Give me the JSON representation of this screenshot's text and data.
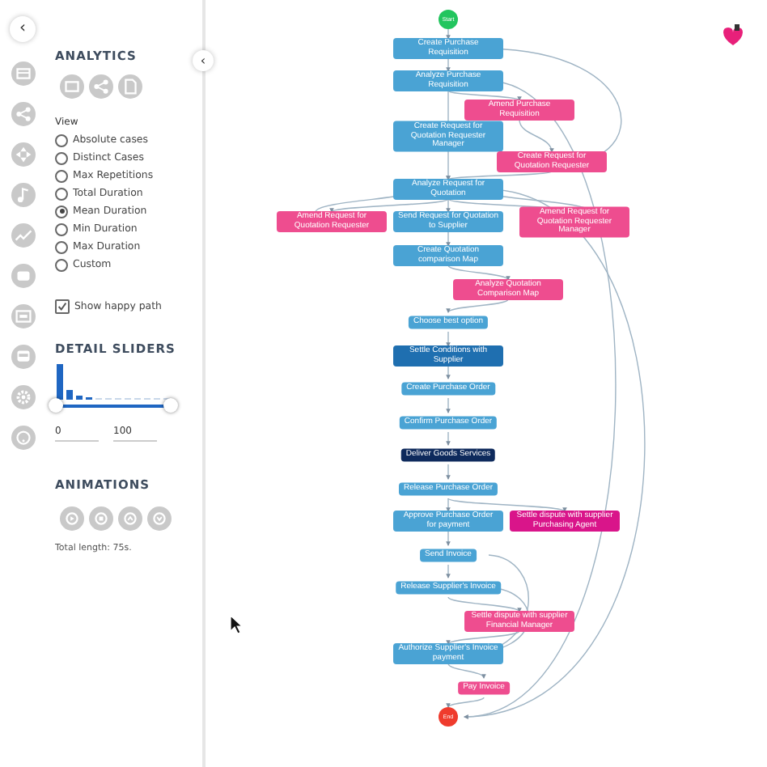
{
  "sidebar": {
    "back_label": "‹"
  },
  "panel": {
    "collapse_label": "‹",
    "analytics_title": "ANALYTICS",
    "view_label": "View",
    "view_options": [
      {
        "label": "Absolute cases",
        "selected": false
      },
      {
        "label": "Distinct Cases",
        "selected": false
      },
      {
        "label": "Max Repetitions",
        "selected": false
      },
      {
        "label": "Total Duration",
        "selected": false
      },
      {
        "label": "Mean Duration",
        "selected": true
      },
      {
        "label": "Min Duration",
        "selected": false
      },
      {
        "label": "Max Duration",
        "selected": false
      },
      {
        "label": "Custom",
        "selected": false
      }
    ],
    "happy_path": {
      "label": "Show happy path",
      "checked": true
    },
    "detail_title": "DETAIL SLIDERS",
    "slider": {
      "level": 1
    },
    "range_min": "0",
    "range_max": "100",
    "animations_title": "ANIMATIONS",
    "total_length": "Total length: 75s."
  },
  "process_map": {
    "nodes": [
      {
        "kind": "start",
        "label": "Start",
        "color": "#22c55e"
      },
      {
        "kind": "activity",
        "label": "Create Purchase Requisition",
        "color": "#4aa3d4"
      },
      {
        "kind": "activity",
        "label": "Analyze Purchase Requisition",
        "color": "#4aa3d4"
      },
      {
        "kind": "activity",
        "label": "Amend Purchase Requisition",
        "color": "#ee4d8f"
      },
      {
        "kind": "activity",
        "label": "Create Request for Quotation Requester Manager",
        "color": "#4aa3d4"
      },
      {
        "kind": "activity",
        "label": "Create Request for Quotation Requester",
        "color": "#ee4d8f"
      },
      {
        "kind": "activity",
        "label": "Analyze Request for Quotation",
        "color": "#4aa3d4"
      },
      {
        "kind": "activity",
        "label": "Amend Request for Quotation Requester",
        "color": "#ee4d8f"
      },
      {
        "kind": "activity",
        "label": "Send Request for Quotation to Supplier",
        "color": "#4aa3d4"
      },
      {
        "kind": "activity",
        "label": "Amend Request for Quotation Requester Manager",
        "color": "#ee4d8f"
      },
      {
        "kind": "activity",
        "label": "Create Quotation comparison Map",
        "color": "#4aa3d4"
      },
      {
        "kind": "activity",
        "label": "Analyze Quotation Comparison Map",
        "color": "#ee4d8f"
      },
      {
        "kind": "activity",
        "label": "Choose best option",
        "color": "#4aa3d4"
      },
      {
        "kind": "activity",
        "label": "Settle Conditions with Supplier",
        "color": "#1f6fb0"
      },
      {
        "kind": "activity",
        "label": "Create Purchase Order",
        "color": "#4aa3d4"
      },
      {
        "kind": "activity",
        "label": "Confirm Purchase Order",
        "color": "#4aa3d4"
      },
      {
        "kind": "activity",
        "label": "Deliver Goods Services",
        "color": "#0e2a5c"
      },
      {
        "kind": "activity",
        "label": "Release Purchase Order",
        "color": "#4aa3d4"
      },
      {
        "kind": "activity",
        "label": "Approve Purchase Order for payment",
        "color": "#4aa3d4"
      },
      {
        "kind": "activity",
        "label": "Settle dispute with supplier Purchasing Agent",
        "color": "#d9158a"
      },
      {
        "kind": "activity",
        "label": "Send Invoice",
        "color": "#4aa3d4"
      },
      {
        "kind": "activity",
        "label": "Release Supplier's Invoice",
        "color": "#4aa3d4"
      },
      {
        "kind": "activity",
        "label": "Settle dispute with supplier Financial Manager",
        "color": "#ee4d8f"
      },
      {
        "kind": "activity",
        "label": "Authorize Supplier's Invoice payment",
        "color": "#4aa3d4"
      },
      {
        "kind": "activity",
        "label": "Pay Invoice",
        "color": "#ee4d8f"
      },
      {
        "kind": "end",
        "label": "End",
        "color": "#ef3b2d"
      }
    ]
  }
}
